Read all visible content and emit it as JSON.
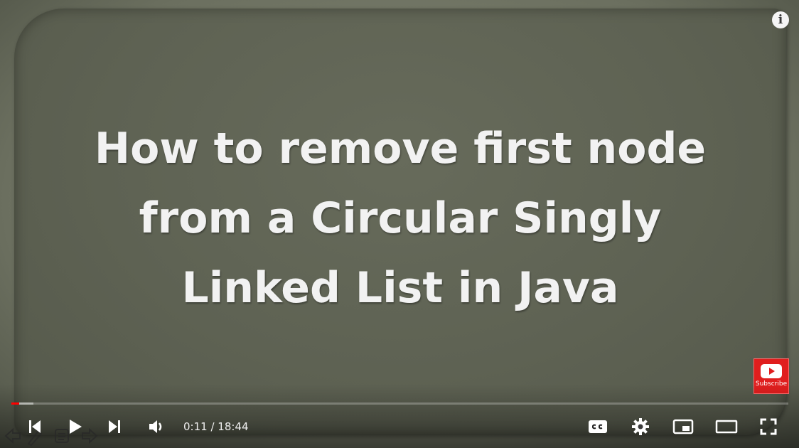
{
  "slide": {
    "title_lines": [
      "How to remove first node",
      "from a Circular Singly",
      "Linked List in Java"
    ]
  },
  "overlay": {
    "info_glyph": "i",
    "subscribe_label": "Subscribe"
  },
  "player": {
    "current_time": "0:11",
    "duration": "18:44",
    "time_display": "0:11 / 18:44",
    "progress_played_fraction": 0.01,
    "progress_loaded_fraction": 0.028
  },
  "controls": {
    "icons": [
      "previous-icon",
      "play-icon",
      "next-icon",
      "volume-icon",
      "subtitles-icon",
      "settings-icon",
      "miniplayer-icon",
      "theater-mode-icon",
      "fullscreen-icon"
    ]
  },
  "colors": {
    "progress_played": "#ff0000",
    "subscribe_bg": "#e01e1e",
    "slide_bg": "#5e6253"
  }
}
